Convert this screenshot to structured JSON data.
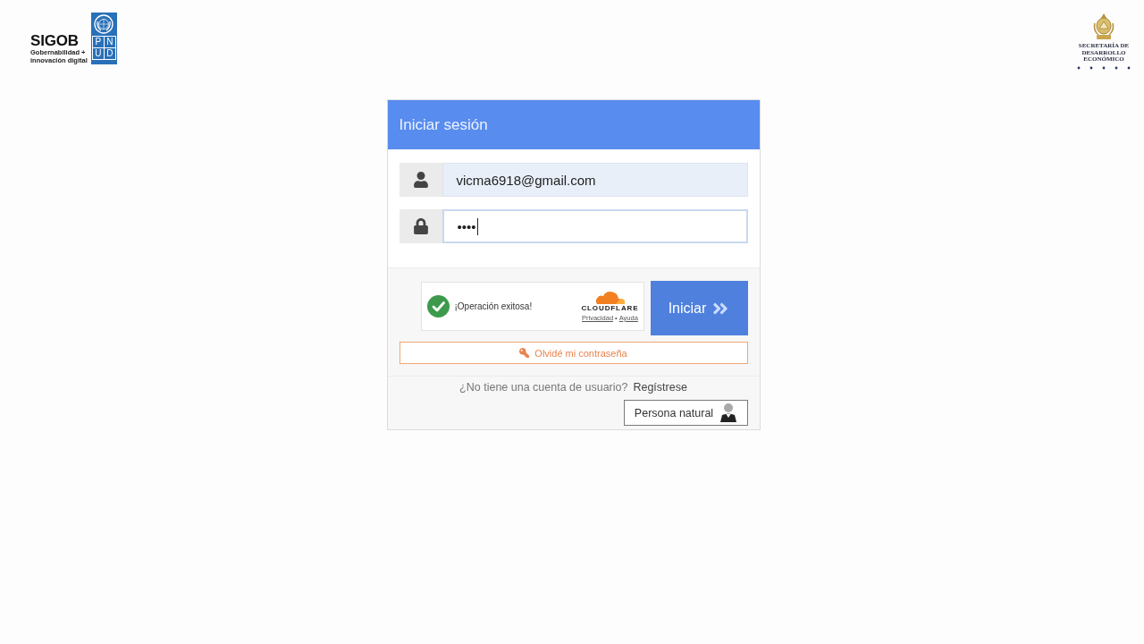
{
  "header": {
    "left_logo": {
      "title": "SIGOB",
      "tagline": [
        "Gobernabilidad +",
        "innovación digital"
      ],
      "pnud_letters": [
        "P",
        "N",
        "U",
        "D"
      ]
    },
    "right_logo": {
      "lines": [
        "SECRETARÍA DE",
        "DESARROLLO",
        "ECONÓMICO"
      ]
    }
  },
  "login": {
    "title": "Iniciar sesión",
    "fields": [
      {
        "kind": "user",
        "value": "vicma6918@gmail.com",
        "focused": false
      },
      {
        "kind": "password",
        "value": "••••",
        "focused": true
      }
    ],
    "captcha": {
      "status": "¡Operación exitosa!",
      "success": true,
      "brand": "CLOUDFLARE",
      "links": [
        "Privacidad",
        "Ayuda"
      ],
      "separator": "•"
    },
    "submit": "Iniciar",
    "forgot": "Olvidé mi contraseña",
    "signup_prompt": "¿No tiene una cuenta de usuario?",
    "signup_link": "Regístrese",
    "person_button": "Persona natural"
  }
}
